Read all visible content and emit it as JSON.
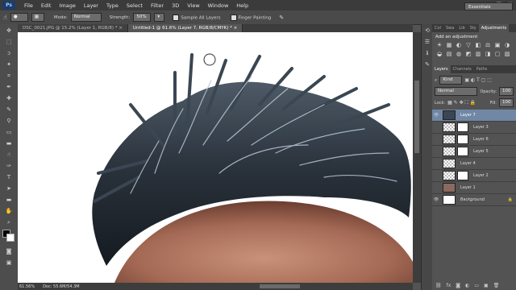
{
  "app": {
    "logo": "Ps"
  },
  "menu": [
    "File",
    "Edit",
    "Image",
    "Layer",
    "Type",
    "Select",
    "Filter",
    "3D",
    "View",
    "Window",
    "Help"
  ],
  "window_controls": [
    "–",
    "□",
    "✕"
  ],
  "options": {
    "mode_label": "Mode:",
    "mode_value": "Normal",
    "strength_label": "Strength:",
    "strength_value": "50%",
    "sample_all": "Sample All Layers",
    "finger_painting": "Finger Painting",
    "workspace": "Essentials"
  },
  "tabs": [
    {
      "label": "DSC_0021.JPG @ 15.2% (Layer 1, RGB/8) *",
      "active": false
    },
    {
      "label": "Untitled-1 @ 61.6% (Layer 7, RGB/8/CMYK) *",
      "active": true
    }
  ],
  "status": {
    "zoom": "61.56%",
    "doc": "Doc: 55.6M/54.3M"
  },
  "adjustments": {
    "tabs": [
      "Col",
      "Swa",
      "Lib",
      "Sty",
      "Adjustments"
    ],
    "heading": "Add an adjustment",
    "icons": [
      "☀",
      "▦",
      "◐",
      "▽",
      "◧",
      "⚖",
      "▣",
      "◑",
      "◒",
      "▤",
      "◍",
      "◩",
      "▥",
      "◨",
      "▢",
      "▧"
    ]
  },
  "layers_panel": {
    "tabs": [
      "Layers",
      "Channels",
      "Paths"
    ],
    "kind": "Kind",
    "blend_mode": "Normal",
    "opacity_label": "Opacity:",
    "opacity_value": "100",
    "lock_label": "Lock:",
    "fill_label": "Fill:",
    "fill_value": "100",
    "layers": [
      {
        "name": "Layer 7",
        "visible": true,
        "active": true,
        "thumb": "photo",
        "mask": false
      },
      {
        "name": "Layer 3",
        "visible": false,
        "active": false,
        "thumb": "checker",
        "mask": true
      },
      {
        "name": "Layer 6",
        "visible": false,
        "active": false,
        "thumb": "checker",
        "mask": true
      },
      {
        "name": "Layer 5",
        "visible": false,
        "active": false,
        "thumb": "checker",
        "mask": true
      },
      {
        "name": "Layer 4",
        "visible": false,
        "active": false,
        "thumb": "checker",
        "mask": false
      },
      {
        "name": "Layer 2",
        "visible": false,
        "active": false,
        "thumb": "checker",
        "mask": true
      },
      {
        "name": "Layer 1",
        "visible": false,
        "active": false,
        "thumb": "photo",
        "mask": false
      },
      {
        "name": "Background",
        "visible": true,
        "active": false,
        "thumb": "white",
        "mask": false
      }
    ]
  },
  "tools": [
    "move-icon",
    "marquee-icon",
    "lasso-icon",
    "magic-wand-icon",
    "crop-icon",
    "eyedropper-icon",
    "healing-icon",
    "brush-icon",
    "stamp-icon",
    "history-brush-icon",
    "eraser-icon",
    "gradient-icon",
    "smudge-icon",
    "dodge-icon",
    "pen-icon",
    "type-icon",
    "path-select-icon",
    "shape-icon",
    "hand-icon",
    "zoom-icon"
  ],
  "colors": {
    "accent": "#7187a6",
    "bg": "#535353"
  }
}
